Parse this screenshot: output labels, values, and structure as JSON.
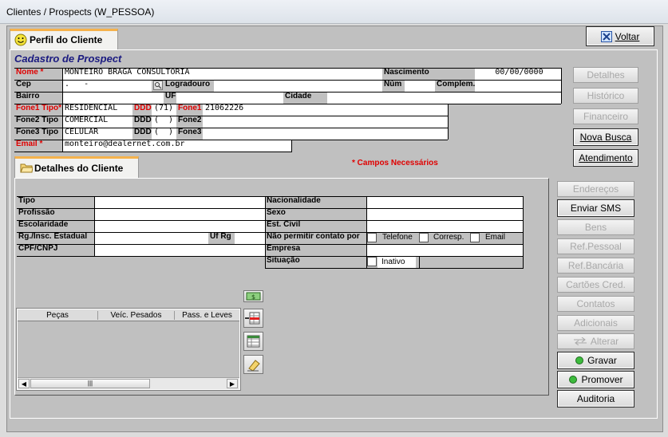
{
  "window": {
    "title": "Clientes / Prospects (W_PESSOA)"
  },
  "tabs": {
    "profile": "Perfil do Cliente",
    "details": "Detalhes do Cliente"
  },
  "buttons": {
    "voltar": "Voltar",
    "detalhes": "Detalhes",
    "historico": "Histórico",
    "financeiro": "Financeiro",
    "nova_busca": "Nova Busca",
    "atendimento": "Atendimento",
    "enderecos": "Endereços",
    "enviar_sms": "Enviar SMS",
    "bens": "Bens",
    "ref_pessoal": "Ref.Pessoal",
    "ref_bancaria": "Ref.Bancária",
    "cartoes": "Cartões Cred.",
    "contatos": "Contatos",
    "adicionais": "Adicionais",
    "alterar": "Alterar",
    "gravar": "Gravar",
    "promover": "Promover",
    "auditoria": "Auditoria"
  },
  "form": {
    "heading": "Cadastro de Prospect",
    "required_note": "* Campos Necessários",
    "labels": {
      "nome": "Nome *",
      "nascimento": "Nascimento",
      "cep": "Cep",
      "logradouro": "Logradouro",
      "num": "Núm",
      "complem": "Complem.",
      "bairro": "Bairro",
      "uf": "UF",
      "cidade": "Cidade",
      "fone1_tipo": "Fone1 Tipo*",
      "fone2_tipo": "Fone2 Tipo",
      "fone3_tipo": "Fone3 Tipo",
      "ddd": "DDD",
      "fone1": "Fone1",
      "fone2": "Fone2",
      "fone3": "Fone3",
      "email": "Email *"
    },
    "values": {
      "nome": "MONTEIRO BRAGA CONSULTORIA",
      "nascimento": "00/00/0000",
      "cep": ".   -",
      "fone1_tipo": "RESIDENCIAL",
      "fone1_ddd": "(71)",
      "fone1": "21062226",
      "fone2_tipo": "COMERCIAL",
      "fone2_ddd": "(  )",
      "fone3_tipo": "CELULAR",
      "fone3_ddd": "(  )",
      "email": "monteiro@dealernet.com.br"
    }
  },
  "details": {
    "labels": {
      "tipo": "Tipo",
      "profissao": "Profissão",
      "escolaridade": "Escolaridade",
      "rg": "Rg./Insc. Estadual",
      "uf_rg": "Uf Rg",
      "cpf": "CPF/CNPJ",
      "nacionalidade": "Nacionalidade",
      "sexo": "Sexo",
      "est_civil": "Est. Civil",
      "nao_permitir": "Não permitir contato por",
      "empresa": "Empresa",
      "situacao": "Situação"
    },
    "checks": {
      "telefone": "Telefone",
      "corresp": "Corresp.",
      "email": "Email",
      "inativo": "Inativo"
    }
  },
  "grid": {
    "columns": [
      "Peças",
      "Veíc. Pesados",
      "Pass. e Leves"
    ]
  },
  "icons": {
    "money": "money-icon",
    "table_add": "table-insert-icon",
    "table_edit": "table-edit-icon",
    "eraser": "eraser-icon"
  }
}
